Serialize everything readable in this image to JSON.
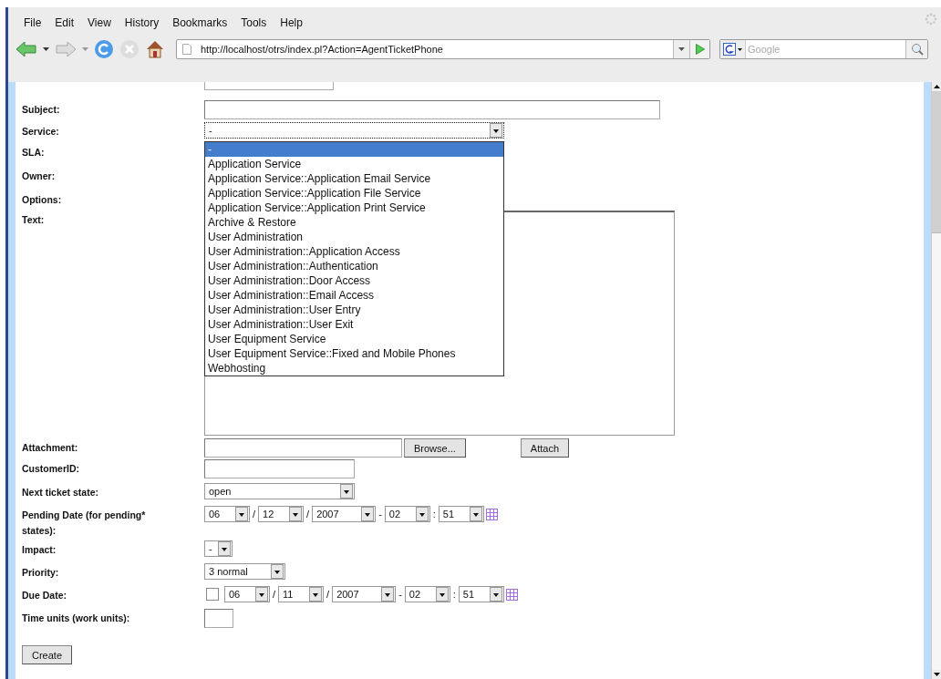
{
  "menu": [
    {
      "label": "File"
    },
    {
      "label": "Edit"
    },
    {
      "label": "View"
    },
    {
      "label": "History"
    },
    {
      "label": "Bookmarks"
    },
    {
      "label": "Tools"
    },
    {
      "label": "Help"
    }
  ],
  "address_bar": {
    "url": "http://localhost/otrs/index.pl?Action=AgentTicketPhone"
  },
  "search": {
    "placeholder": "Google"
  },
  "form": {
    "rows": [
      {
        "kind": "text",
        "label": "Subject:"
      },
      {
        "kind": "select",
        "label": "Service:",
        "value": "-",
        "expanded": true,
        "options": [
          {
            "label": "-",
            "selected": true
          },
          {
            "label": "Application Service",
            "selected": false
          },
          {
            "label": "Application Service::Application Email Service",
            "selected": false
          },
          {
            "label": "Application Service::Application File Service",
            "selected": false
          },
          {
            "label": "Application Service::Application Print Service",
            "selected": false
          },
          {
            "label": "Archive & Restore",
            "selected": false
          },
          {
            "label": "User Administration",
            "selected": false
          },
          {
            "label": "User Administration::Application Access",
            "selected": false
          },
          {
            "label": "User Administration::Authentication",
            "selected": false
          },
          {
            "label": "User Administration::Door Access",
            "selected": false
          },
          {
            "label": "User Administration::Email Access",
            "selected": false
          },
          {
            "label": "User Administration::User Entry",
            "selected": false
          },
          {
            "label": "User Administration::User Exit",
            "selected": false
          },
          {
            "label": "User Equipment Service",
            "selected": false
          },
          {
            "label": "User Equipment Service::Fixed and Mobile Phones",
            "selected": false
          },
          {
            "label": "Webhosting",
            "selected": false
          }
        ]
      },
      {
        "kind": "covered",
        "label": "SLA:"
      },
      {
        "kind": "covered",
        "label": "Owner:"
      },
      {
        "kind": "covered",
        "label": "Options:"
      },
      {
        "kind": "textarea",
        "label": "Text:"
      },
      {
        "kind": "file",
        "label": "Attachment:",
        "browse": "Browse...",
        "attach": "Attach"
      },
      {
        "kind": "text",
        "label": "CustomerID:"
      },
      {
        "kind": "select",
        "label": "Next ticket state:",
        "value": "open",
        "expanded": false
      },
      {
        "kind": "date",
        "label": "Pending Date (for pending* states):",
        "parts": [
          "06",
          "12",
          "2007",
          "02",
          "51"
        ],
        "separators": [
          "/",
          "/",
          "-",
          ":"
        ]
      },
      {
        "kind": "select",
        "label": "Impact:",
        "value": "-",
        "expanded": false
      },
      {
        "kind": "select",
        "label": "Priority:",
        "value": "3 normal",
        "expanded": false
      },
      {
        "kind": "date",
        "label": "Due Date:",
        "checked": false,
        "parts": [
          "06",
          "11",
          "2007",
          "02",
          "51"
        ],
        "separators": [
          "/",
          "/",
          "-",
          ":"
        ]
      },
      {
        "kind": "text",
        "label": "Time units (work units):"
      }
    ]
  },
  "create_button": "Create"
}
